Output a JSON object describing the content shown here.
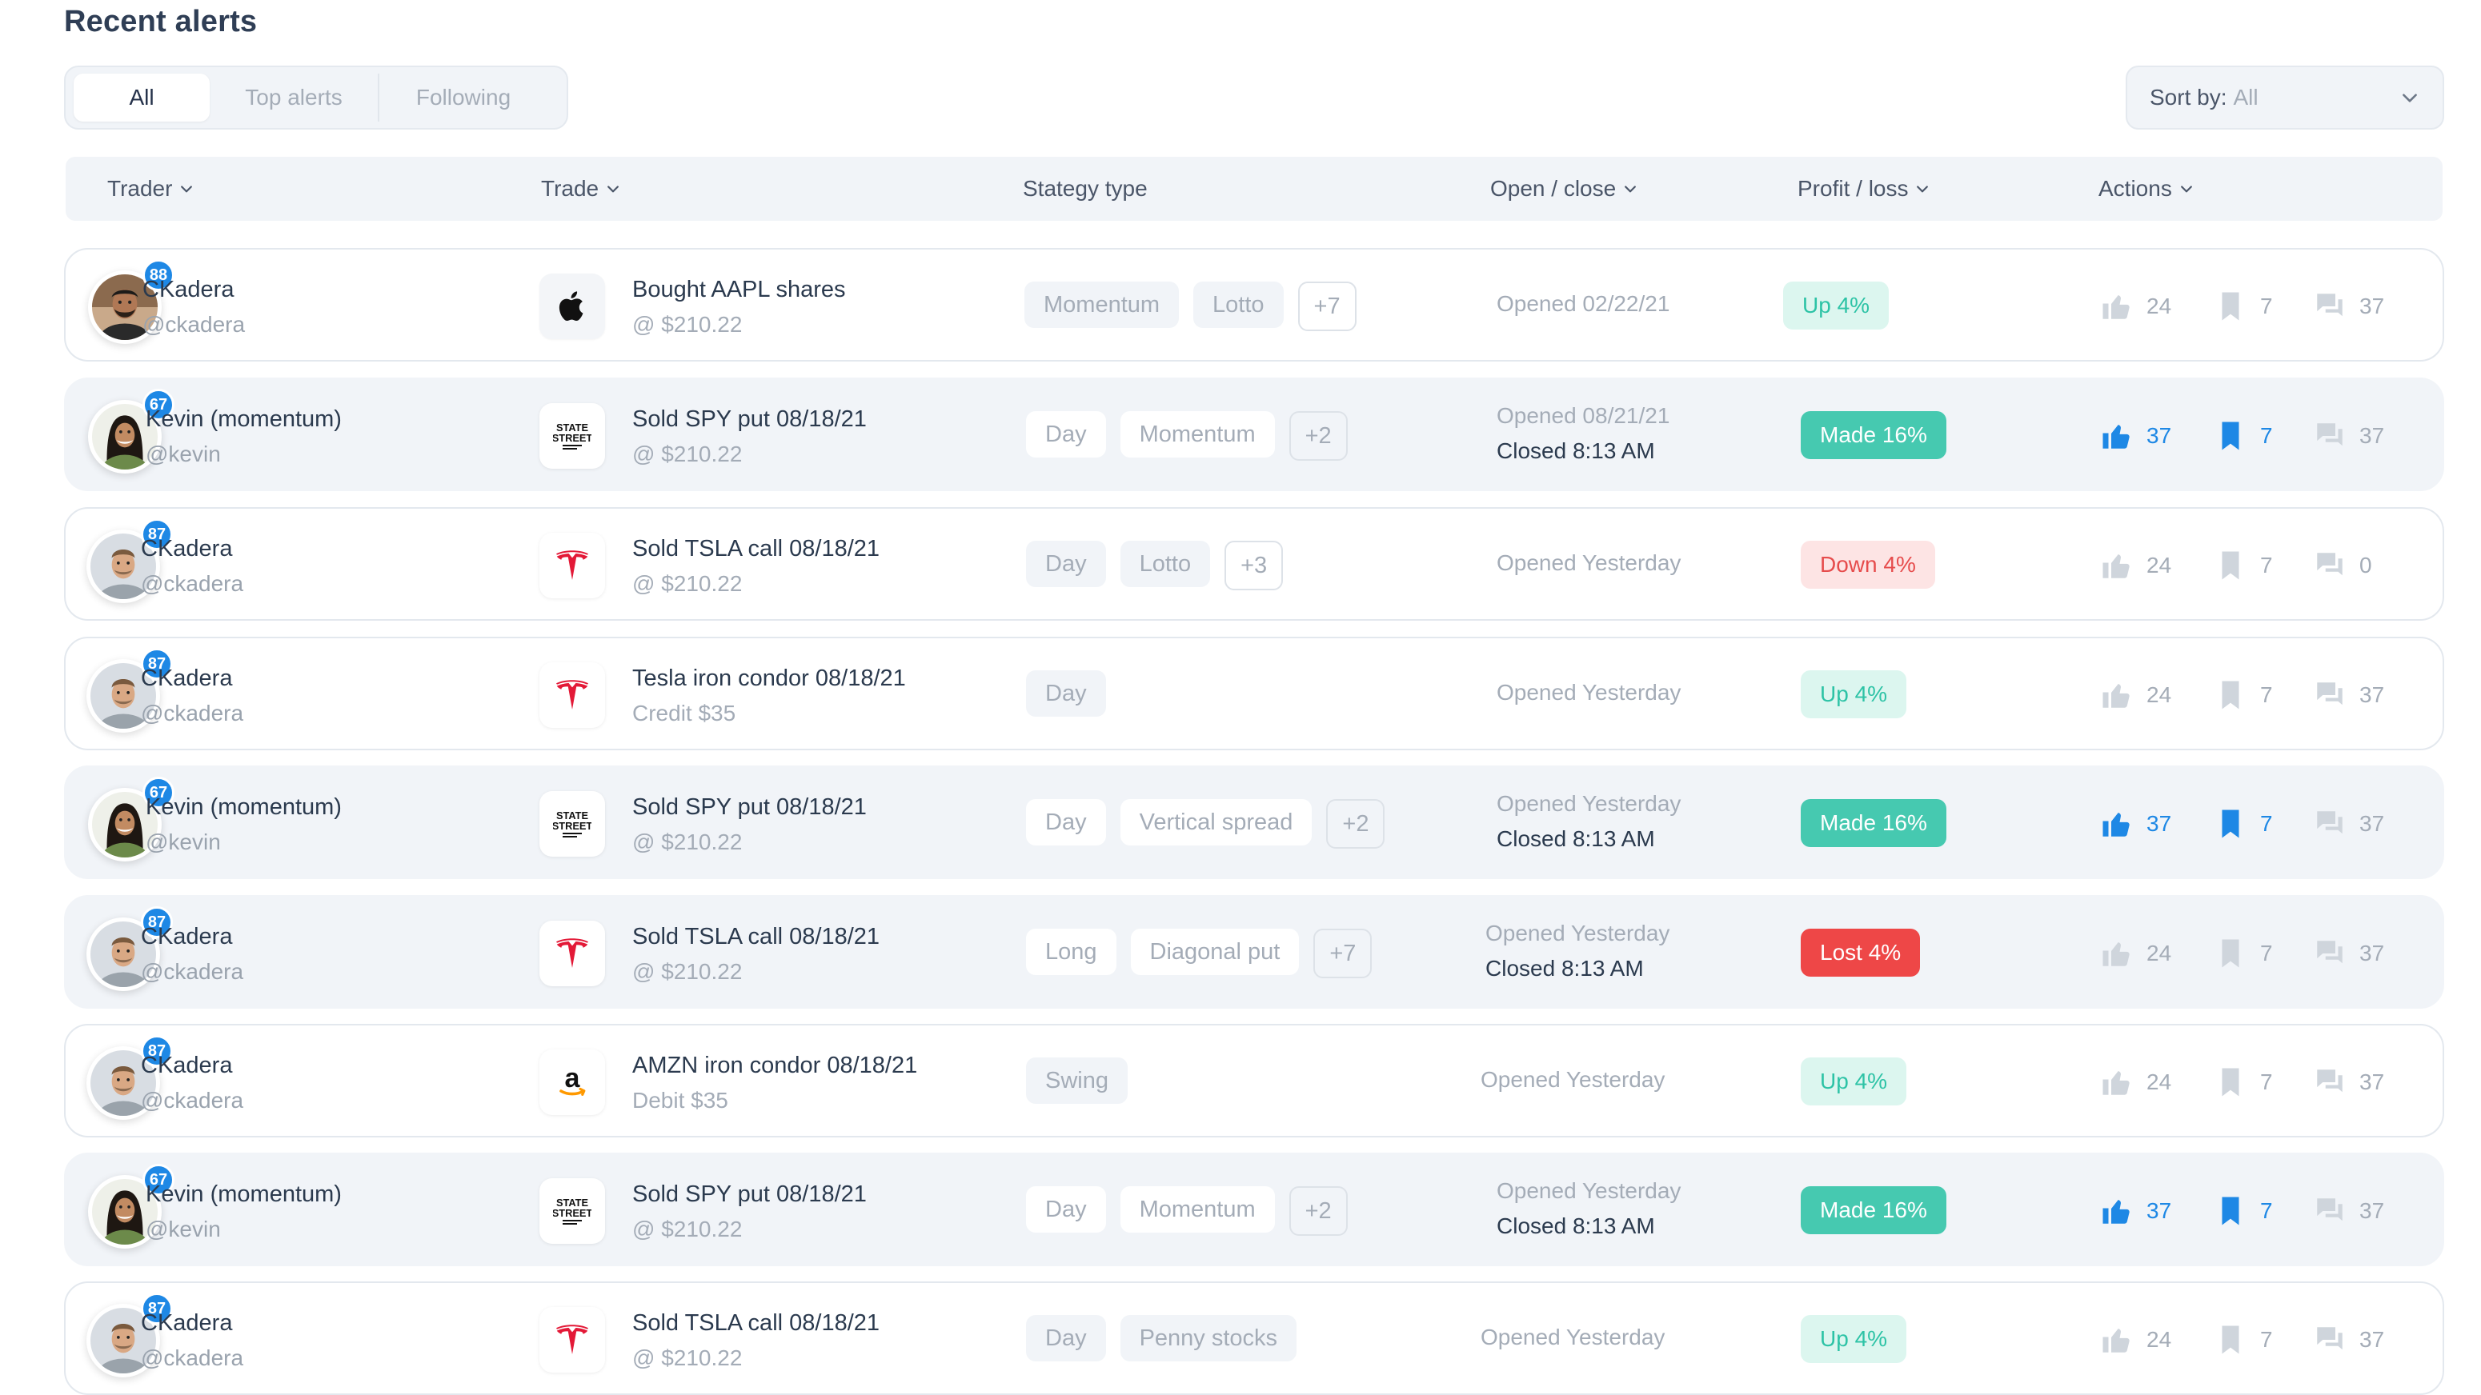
{
  "page": {
    "title": "Recent alerts"
  },
  "tabs": [
    {
      "label": "All",
      "active": true
    },
    {
      "label": "Top alerts",
      "active": false
    },
    {
      "label": "Following",
      "active": false
    }
  ],
  "sort": {
    "label": "Sort by:",
    "value": "All"
  },
  "columns": {
    "trader": "Trader",
    "trade": "Trade",
    "strategy": "Stategy type",
    "open_close": "Open / close",
    "profit_loss": "Profit / loss",
    "actions": "Actions"
  },
  "colors": {
    "accent": "#1e88e5",
    "up_bg": "#dcf6ef",
    "up_text": "#2dc3a6",
    "made_bg": "#46c9b0",
    "down_bg": "#fde4e4",
    "down_text": "#e64c4c",
    "lost_bg": "#ee4747"
  },
  "rows": [
    {
      "style": "white",
      "trader": {
        "name": "CKadera",
        "handle": "@ckadera",
        "score": "88",
        "avatar": "bearded-man"
      },
      "trade": {
        "logo": "apple",
        "title": "Bought AAPL shares",
        "sub": "@ $210.22"
      },
      "tags": [
        "Momentum",
        "Lotto"
      ],
      "more": "+7",
      "opened": "Opened 02/22/21",
      "closed": "",
      "pl": {
        "kind": "up",
        "label": "Up 4%"
      },
      "likes": "24",
      "saves": "7",
      "comments": "37",
      "liked": false,
      "saved": false
    },
    {
      "style": "gray",
      "trader": {
        "name": "Kevin (momentum)",
        "handle": "@kevin",
        "score": "67",
        "avatar": "woman"
      },
      "trade": {
        "logo": "state-street",
        "title": "Sold SPY put 08/18/21",
        "sub": "@ $210.22"
      },
      "tags": [
        "Day",
        "Momentum"
      ],
      "more": "+2",
      "opened": "Opened 08/21/21",
      "closed": "Closed 8:13 AM",
      "pl": {
        "kind": "made",
        "label": "Made 16%"
      },
      "likes": "37",
      "saves": "7",
      "comments": "37",
      "liked": true,
      "saved": true
    },
    {
      "style": "white",
      "trader": {
        "name": "CKadera",
        "handle": "@ckadera",
        "score": "87",
        "avatar": "man"
      },
      "trade": {
        "logo": "tesla",
        "title": "Sold TSLA call 08/18/21",
        "sub": "@ $210.22"
      },
      "tags": [
        "Day",
        "Lotto"
      ],
      "more": "+3",
      "opened": "Opened Yesterday",
      "closed": "",
      "pl": {
        "kind": "down",
        "label": "Down 4%"
      },
      "likes": "24",
      "saves": "7",
      "comments": "0",
      "liked": false,
      "saved": false
    },
    {
      "style": "white",
      "trader": {
        "name": "CKadera",
        "handle": "@ckadera",
        "score": "87",
        "avatar": "man"
      },
      "trade": {
        "logo": "tesla",
        "title": "Tesla iron condor 08/18/21",
        "sub": "Credit $35"
      },
      "tags": [
        "Day"
      ],
      "more": "",
      "opened": "Opened Yesterday",
      "closed": "",
      "pl": {
        "kind": "up",
        "label": "Up 4%"
      },
      "likes": "24",
      "saves": "7",
      "comments": "37",
      "liked": false,
      "saved": false
    },
    {
      "style": "gray",
      "trader": {
        "name": "Kevin (momentum)",
        "handle": "@kevin",
        "score": "67",
        "avatar": "woman"
      },
      "trade": {
        "logo": "state-street",
        "title": "Sold SPY put 08/18/21",
        "sub": "@ $210.22"
      },
      "tags": [
        "Day",
        "Vertical spread"
      ],
      "more": "+2",
      "opened": "Opened Yesterday",
      "closed": "Closed 8:13 AM",
      "pl": {
        "kind": "made",
        "label": "Made 16%"
      },
      "likes": "37",
      "saves": "7",
      "comments": "37",
      "liked": true,
      "saved": true
    },
    {
      "style": "gray",
      "trader": {
        "name": "CKadera",
        "handle": "@ckadera",
        "score": "87",
        "avatar": "man"
      },
      "trade": {
        "logo": "tesla",
        "title": "Sold TSLA call 08/18/21",
        "sub": "@ $210.22"
      },
      "tags": [
        "Long",
        "Diagonal put"
      ],
      "more": "+7",
      "opened": "Opened Yesterday",
      "closed": "Closed 8:13 AM",
      "pl": {
        "kind": "lost",
        "label": "Lost 4%"
      },
      "likes": "24",
      "saves": "7",
      "comments": "37",
      "liked": false,
      "saved": false
    },
    {
      "style": "white",
      "trader": {
        "name": "CKadera",
        "handle": "@ckadera",
        "score": "87",
        "avatar": "man"
      },
      "trade": {
        "logo": "amazon",
        "title": "AMZN iron condor 08/18/21",
        "sub": "Debit $35"
      },
      "tags": [
        "Swing"
      ],
      "more": "",
      "opened": "Opened Yesterday",
      "closed": "",
      "pl": {
        "kind": "up",
        "label": "Up 4%"
      },
      "likes": "24",
      "saves": "7",
      "comments": "37",
      "liked": false,
      "saved": false
    },
    {
      "style": "gray",
      "trader": {
        "name": "Kevin (momentum)",
        "handle": "@kevin",
        "score": "67",
        "avatar": "woman"
      },
      "trade": {
        "logo": "state-street",
        "title": "Sold SPY put 08/18/21",
        "sub": "@ $210.22"
      },
      "tags": [
        "Day",
        "Momentum"
      ],
      "more": "+2",
      "opened": "Opened Yesterday",
      "closed": "Closed 8:13 AM",
      "pl": {
        "kind": "made",
        "label": "Made 16%"
      },
      "likes": "37",
      "saves": "7",
      "comments": "37",
      "liked": true,
      "saved": true
    },
    {
      "style": "white",
      "trader": {
        "name": "CKadera",
        "handle": "@ckadera",
        "score": "87",
        "avatar": "man"
      },
      "trade": {
        "logo": "tesla",
        "title": "Sold TSLA call 08/18/21",
        "sub": "@ $210.22"
      },
      "tags": [
        "Day",
        "Penny stocks"
      ],
      "more": "",
      "opened": "Opened Yesterday",
      "closed": "",
      "pl": {
        "kind": "up",
        "label": "Up 4%"
      },
      "likes": "24",
      "saves": "7",
      "comments": "37",
      "liked": false,
      "saved": false
    }
  ]
}
